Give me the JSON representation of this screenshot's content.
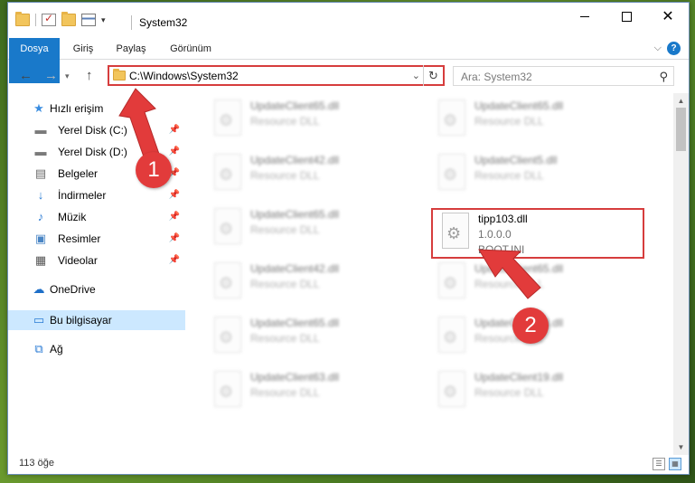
{
  "window": {
    "title": "System32",
    "controls": {
      "minimize": "",
      "maximize": "",
      "close": "✕"
    }
  },
  "ribbon": {
    "tabs": [
      "Dosya",
      "Giriş",
      "Paylaş",
      "Görünüm"
    ],
    "chevron": "⌵",
    "help": "?"
  },
  "address": {
    "path": "C:\\Windows\\System32",
    "dropdown": "⌄",
    "refresh": "↻"
  },
  "search": {
    "placeholder": "Ara: System32",
    "icon": "⚲"
  },
  "sidebar": {
    "items": [
      {
        "label": "Hızlı erişim",
        "icon": "star-icon",
        "glyph": "★",
        "color": "#3a8de0",
        "pinned": false
      },
      {
        "label": "Yerel Disk (C:)",
        "icon": "drive-c-icon",
        "glyph": "▬",
        "color": "#7a7a7a",
        "pinned": true
      },
      {
        "label": "Yerel Disk (D:)",
        "icon": "drive-d-icon",
        "glyph": "▬",
        "color": "#7a7a7a",
        "pinned": true
      },
      {
        "label": "Belgeler",
        "icon": "documents-icon",
        "glyph": "▤",
        "color": "#6a6a6a",
        "pinned": true
      },
      {
        "label": "İndirmeler",
        "icon": "downloads-icon",
        "glyph": "↓",
        "color": "#2a7bd4",
        "pinned": true
      },
      {
        "label": "Müzik",
        "icon": "music-icon",
        "glyph": "♪",
        "color": "#2a7bd4",
        "pinned": true
      },
      {
        "label": "Resimler",
        "icon": "pictures-icon",
        "glyph": "▣",
        "color": "#4a86c5",
        "pinned": true
      },
      {
        "label": "Videolar",
        "icon": "videos-icon",
        "glyph": "▦",
        "color": "#555",
        "pinned": true
      },
      {
        "label": "OneDrive",
        "icon": "onedrive-icon",
        "glyph": "☁",
        "color": "#1e6fc8",
        "pinned": false
      },
      {
        "label": "Bu bilgisayar",
        "icon": "this-pc-icon",
        "glyph": "▭",
        "color": "#2a7bd4",
        "pinned": false
      },
      {
        "label": "Ağ",
        "icon": "network-icon",
        "glyph": "⧉",
        "color": "#2a7bd4",
        "pinned": false
      }
    ],
    "pin_glyph": "📌"
  },
  "files": [
    {
      "name": "UpdateClient65.dll",
      "type": "Resource DLL",
      "extra": "",
      "blurred": true
    },
    {
      "name": "UpdateClient65.dll",
      "type": "Resource DLL",
      "extra": "",
      "blurred": true
    },
    {
      "name": "UpdateClient42.dll",
      "type": "Resource DLL",
      "extra": "",
      "blurred": true
    },
    {
      "name": "UpdateClient5.dll",
      "type": "Resource DLL",
      "extra": "",
      "blurred": true
    },
    {
      "name": "UpdateClient65.dll",
      "type": "Resource DLL",
      "extra": "",
      "blurred": true
    },
    {
      "name": "tipp103.dll",
      "type": "1.0.0.0",
      "extra": "BOOT.INI",
      "blurred": false
    },
    {
      "name": "UpdateClient42.dll",
      "type": "Resource DLL",
      "extra": "",
      "blurred": true
    },
    {
      "name": "UpdateClient65.dll",
      "type": "Resource DLL",
      "extra": "",
      "blurred": true
    },
    {
      "name": "UpdateClient65.dll",
      "type": "Resource DLL",
      "extra": "",
      "blurred": true
    },
    {
      "name": "UpdateClient63.dll",
      "type": "Resource DLL",
      "extra": "",
      "blurred": true
    },
    {
      "name": "UpdateClient63.dll",
      "type": "Resource DLL",
      "extra": "",
      "blurred": true
    },
    {
      "name": "UpdateClient19.dll",
      "type": "Resource DLL",
      "extra": "",
      "blurred": true
    }
  ],
  "status": {
    "count": "113 öğe"
  },
  "annotations": {
    "step1": "1",
    "step2": "2",
    "color": "#e23b3b"
  },
  "colors": {
    "accent": "#1979ca",
    "highlight": "#d63d3d",
    "selected": "#cce8ff"
  }
}
